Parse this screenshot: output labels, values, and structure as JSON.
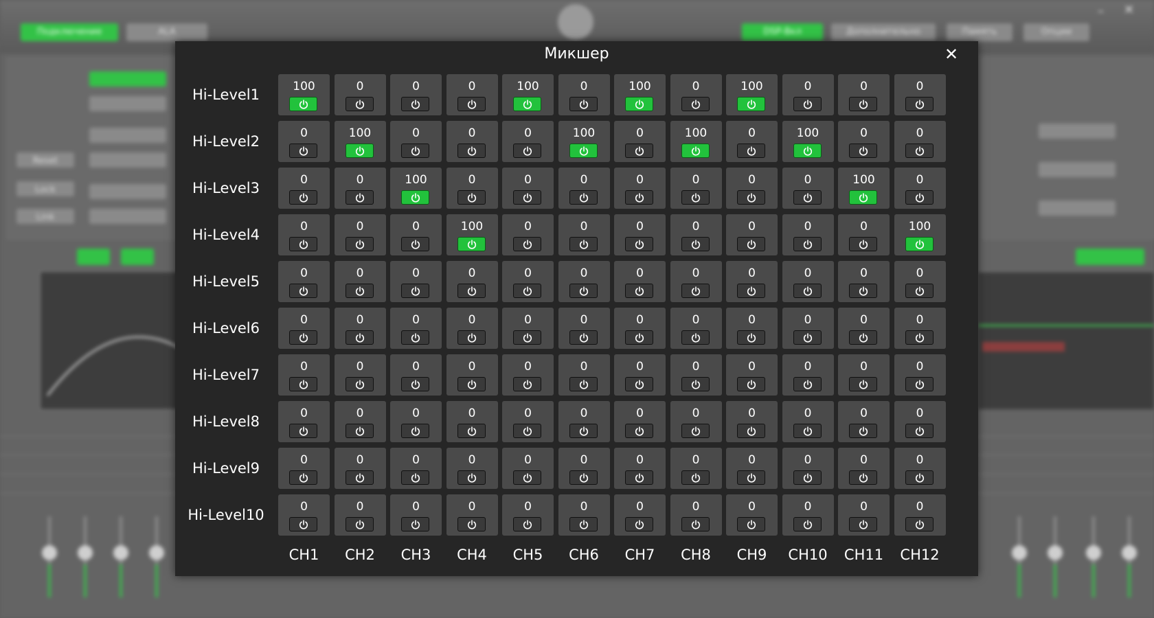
{
  "background": {
    "top_buttons": [
      "Подключение",
      "ALA",
      "DSP-Вкл",
      "Дополнительно",
      "Память",
      "Опции"
    ],
    "left_buttons": [
      "Reset",
      "Lock",
      "Link"
    ]
  },
  "dialog": {
    "title": "Микшер",
    "close_symbol": "✕",
    "columns": [
      "CH1",
      "CH2",
      "CH3",
      "CH4",
      "CH5",
      "CH6",
      "CH7",
      "CH8",
      "CH9",
      "CH10",
      "CH11",
      "CH12"
    ],
    "rows": [
      {
        "label": "Hi-Level1",
        "values": [
          100,
          0,
          0,
          0,
          100,
          0,
          100,
          0,
          100,
          0,
          0,
          0
        ],
        "on": [
          true,
          false,
          false,
          false,
          true,
          false,
          true,
          false,
          true,
          false,
          false,
          false
        ]
      },
      {
        "label": "Hi-Level2",
        "values": [
          0,
          100,
          0,
          0,
          0,
          100,
          0,
          100,
          0,
          100,
          0,
          0
        ],
        "on": [
          false,
          true,
          false,
          false,
          false,
          true,
          false,
          true,
          false,
          true,
          false,
          false
        ]
      },
      {
        "label": "Hi-Level3",
        "values": [
          0,
          0,
          100,
          0,
          0,
          0,
          0,
          0,
          0,
          0,
          100,
          0
        ],
        "on": [
          false,
          false,
          true,
          false,
          false,
          false,
          false,
          false,
          false,
          false,
          true,
          false
        ]
      },
      {
        "label": "Hi-Level4",
        "values": [
          0,
          0,
          0,
          100,
          0,
          0,
          0,
          0,
          0,
          0,
          0,
          100
        ],
        "on": [
          false,
          false,
          false,
          true,
          false,
          false,
          false,
          false,
          false,
          false,
          false,
          true
        ]
      },
      {
        "label": "Hi-Level5",
        "values": [
          0,
          0,
          0,
          0,
          0,
          0,
          0,
          0,
          0,
          0,
          0,
          0
        ],
        "on": [
          false,
          false,
          false,
          false,
          false,
          false,
          false,
          false,
          false,
          false,
          false,
          false
        ]
      },
      {
        "label": "Hi-Level6",
        "values": [
          0,
          0,
          0,
          0,
          0,
          0,
          0,
          0,
          0,
          0,
          0,
          0
        ],
        "on": [
          false,
          false,
          false,
          false,
          false,
          false,
          false,
          false,
          false,
          false,
          false,
          false
        ]
      },
      {
        "label": "Hi-Level7",
        "values": [
          0,
          0,
          0,
          0,
          0,
          0,
          0,
          0,
          0,
          0,
          0,
          0
        ],
        "on": [
          false,
          false,
          false,
          false,
          false,
          false,
          false,
          false,
          false,
          false,
          false,
          false
        ]
      },
      {
        "label": "Hi-Level8",
        "values": [
          0,
          0,
          0,
          0,
          0,
          0,
          0,
          0,
          0,
          0,
          0,
          0
        ],
        "on": [
          false,
          false,
          false,
          false,
          false,
          false,
          false,
          false,
          false,
          false,
          false,
          false
        ]
      },
      {
        "label": "Hi-Level9",
        "values": [
          0,
          0,
          0,
          0,
          0,
          0,
          0,
          0,
          0,
          0,
          0,
          0
        ],
        "on": [
          false,
          false,
          false,
          false,
          false,
          false,
          false,
          false,
          false,
          false,
          false,
          false
        ]
      },
      {
        "label": "Hi-Level10",
        "values": [
          0,
          0,
          0,
          0,
          0,
          0,
          0,
          0,
          0,
          0,
          0,
          0
        ],
        "on": [
          false,
          false,
          false,
          false,
          false,
          false,
          false,
          false,
          false,
          false,
          false,
          false
        ]
      }
    ]
  },
  "colors": {
    "on": "#22c23c",
    "off": "#3a3a3a",
    "cell": "#4a4a4a",
    "dialog": "#262626"
  }
}
